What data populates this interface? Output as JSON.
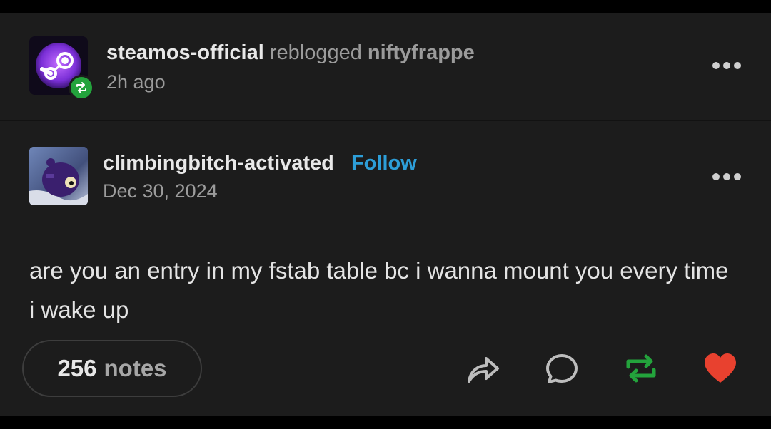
{
  "reblog_header": {
    "reblogger": "steamos-official",
    "verb": "reblogged",
    "original_reblogged": "niftyfrappe",
    "time": "2h ago"
  },
  "post": {
    "author": "climbingbitch-activated",
    "follow_label": "Follow",
    "date": "Dec 30, 2024",
    "text": "are you an entry in my fstab table bc i wanna mount you every time i wake up"
  },
  "footer": {
    "notes_count": "256",
    "notes_label": "notes"
  },
  "colors": {
    "background": "#1c1c1c",
    "follow": "#2d9ed8",
    "reblog_green": "#23a33c",
    "like_red": "#e8412f"
  },
  "icons": [
    "more-icon",
    "share-icon",
    "reply-icon",
    "reblog-icon",
    "heart-icon"
  ]
}
